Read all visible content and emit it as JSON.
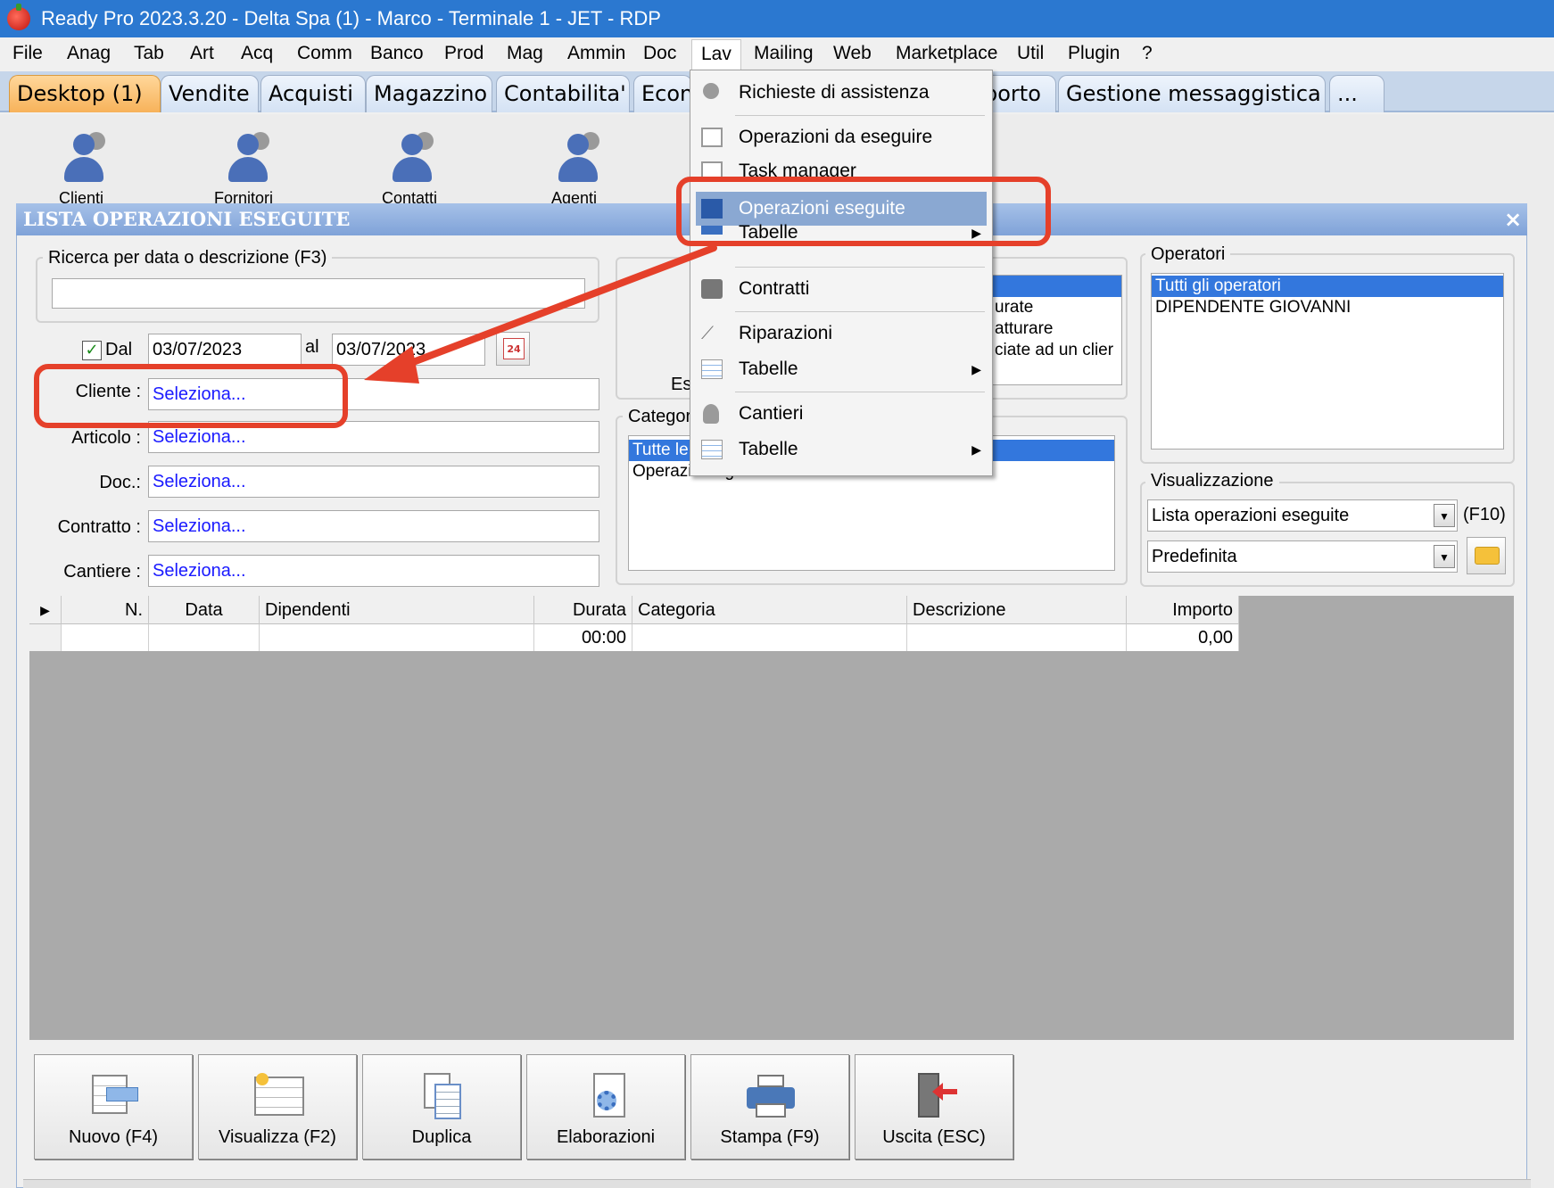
{
  "window_title": "Ready Pro 2023.3.20 - Delta Spa (1) - Marco - Terminale 1 - JET - RDP",
  "menubar": [
    "File",
    "Anag",
    "Tab",
    "Art",
    "Acq",
    "Comm",
    "Banco",
    "Prod",
    "Mag",
    "Ammin",
    "Doc",
    "Lav",
    "Mailing",
    "Web",
    "Marketplace",
    "Util",
    "Plugin",
    "?"
  ],
  "tabs": [
    "Desktop (1)",
    "Vendite",
    "Acquisti",
    "Magazzino",
    "Contabilita'",
    "Econ",
    "porto",
    "Gestione messaggistica",
    "..."
  ],
  "desktop_icons": [
    "Clienti",
    "Fornitori",
    "Contatti",
    "Agenti"
  ],
  "window": {
    "title": "LISTA OPERAZIONI ESEGUITE",
    "close": "×",
    "search": {
      "title": "Ricerca per data o descrizione (F3)",
      "value": ""
    },
    "dal_label": "Dal",
    "date_from": "03/07/2023",
    "al_label": "al",
    "date_to": "03/07/2023",
    "calendar_day": "24",
    "fields": [
      {
        "label": "Cliente :",
        "value": "Seleziona..."
      },
      {
        "label": "Articolo :",
        "value": "Seleziona..."
      },
      {
        "label": "Doc.:",
        "value": "Seleziona..."
      },
      {
        "label": "Contratto :",
        "value": "Seleziona..."
      },
      {
        "label": "Cantiere :",
        "value": "Seleziona..."
      }
    ],
    "es_label": "Es",
    "stato_items": [
      "urate",
      "atturare",
      "ciate ad un clier"
    ],
    "categoria": {
      "title": "Categor",
      "items": [
        "Tutte le",
        "Operazione generica"
      ]
    },
    "operatori": {
      "title": "Operatori",
      "items": [
        "Tutti gli operatori",
        "DIPENDENTE GIOVANNI"
      ]
    },
    "visualizzazione": {
      "title": "Visualizzazione",
      "combo1": "Lista operazioni eseguite",
      "f10": "(F10)",
      "combo2": "Predefinita"
    },
    "grid": {
      "columns": [
        "N.",
        "Data",
        "Dipendenti",
        "Durata",
        "Categoria",
        "Descrizione",
        "Importo"
      ],
      "row": {
        "durata": "00:00",
        "importo": "0,00"
      }
    },
    "buttons": [
      "Nuovo (F4)",
      "Visualizza (F2)",
      "Duplica",
      "Elaborazioni",
      "Stampa (F9)",
      "Uscita (ESC)"
    ]
  },
  "lav_menu": [
    {
      "label": "Richieste di assistenza",
      "icon": "person-icon"
    },
    {
      "label": "Operazioni da eseguire",
      "icon": "checklist-icon"
    },
    {
      "label": "Task manager",
      "icon": "checklist-icon"
    },
    {
      "label": "Operazioni eseguite",
      "icon": "book-icon",
      "highlighted": true
    },
    {
      "label": "Tabelle",
      "icon": "table-icon",
      "submenu": true
    },
    {
      "label": "Contratti",
      "icon": "briefcase-icon"
    },
    {
      "label": "Riparazioni",
      "icon": "wrench-icon"
    },
    {
      "label": "Tabelle",
      "icon": "table-icon",
      "submenu": true
    },
    {
      "label": "Cantieri",
      "icon": "worker-icon"
    },
    {
      "label": "Tabelle",
      "icon": "table-icon",
      "submenu": true
    }
  ],
  "annotation_color": "#e5402a"
}
